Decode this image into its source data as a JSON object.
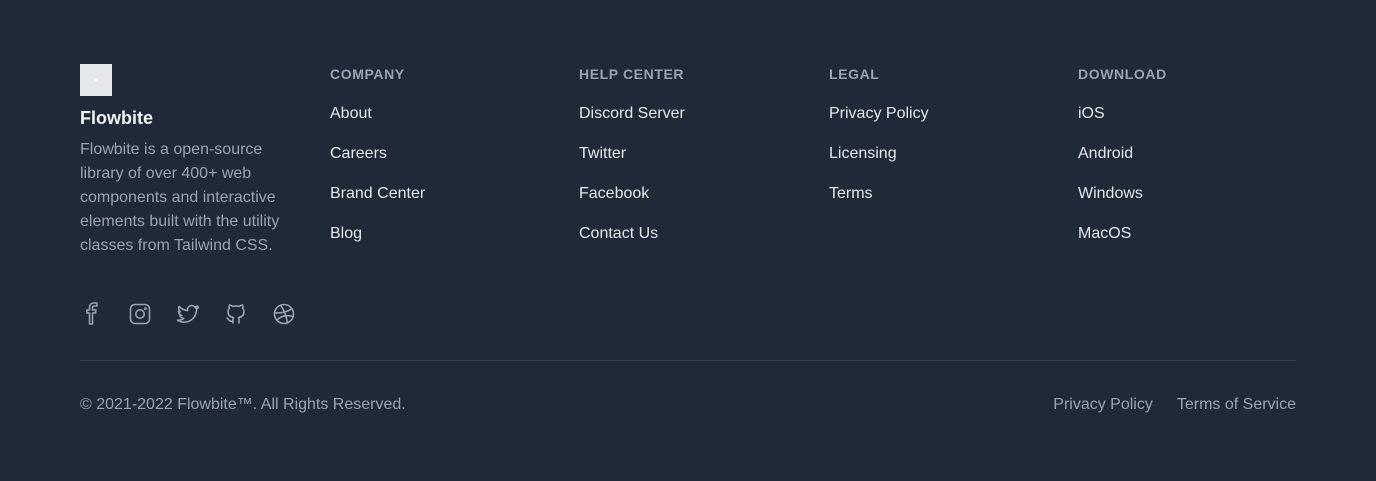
{
  "brand": {
    "name": "Flowbite",
    "description": "Flowbite is a open-source library of over 400+ web components and interactive elements built with the utility classes from Tailwind CSS."
  },
  "social": [
    {
      "icon": "facebook-icon"
    },
    {
      "icon": "instagram-icon"
    },
    {
      "icon": "twitter-icon"
    },
    {
      "icon": "github-icon"
    },
    {
      "icon": "dribbble-icon"
    }
  ],
  "columns": [
    {
      "heading": "COMPANY",
      "links": [
        "About",
        "Careers",
        "Brand Center",
        "Blog"
      ]
    },
    {
      "heading": "HELP CENTER",
      "links": [
        "Discord Server",
        "Twitter",
        "Facebook",
        "Contact Us"
      ]
    },
    {
      "heading": "LEGAL",
      "links": [
        "Privacy Policy",
        "Licensing",
        "Terms"
      ]
    },
    {
      "heading": "DOWNLOAD",
      "links": [
        "iOS",
        "Android",
        "Windows",
        "MacOS"
      ]
    }
  ],
  "bottom": {
    "copyright": "© 2021-2022 Flowbite™. All Rights Reserved.",
    "links": [
      "Privacy Policy",
      "Terms of Service"
    ]
  },
  "colors": {
    "background": "#1f2937",
    "text_primary": "#e5e7eb",
    "text_muted": "#9ca3af",
    "divider": "#374151"
  }
}
